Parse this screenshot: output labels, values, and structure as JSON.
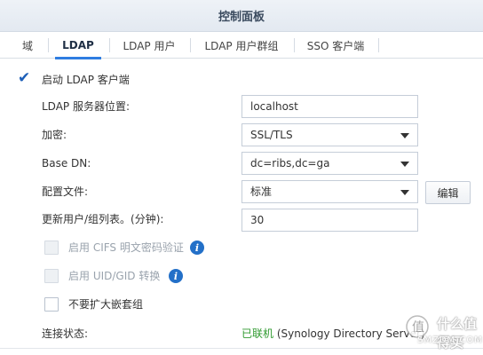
{
  "window": {
    "title": "控制面板"
  },
  "tabs": [
    {
      "label": "域"
    },
    {
      "label": "LDAP"
    },
    {
      "label": "LDAP 用户"
    },
    {
      "label": "LDAP 用户群组"
    },
    {
      "label": "SSO 客户端"
    }
  ],
  "form": {
    "enable_client": {
      "label": "启动 LDAP 客户端",
      "checked": true
    },
    "server_location": {
      "label": "LDAP 服务器位置:",
      "value": "localhost"
    },
    "encryption": {
      "label": "加密:",
      "value": "SSL/TLS"
    },
    "base_dn": {
      "label": "Base DN:",
      "value": "dc=ribs,dc=ga"
    },
    "profile": {
      "label": "配置文件:",
      "value": "标准",
      "edit_button": "编辑"
    },
    "refresh_interval": {
      "label": "更新用户/组列表。(分钟):",
      "value": "30"
    },
    "cifs_auth": {
      "label": "启用 CIFS 明文密码验证",
      "checked": false,
      "disabled": true
    },
    "uid_gid": {
      "label": "启用 UID/GID 转换",
      "checked": false,
      "disabled": true
    },
    "no_nested": {
      "label": "不要扩大嵌套组",
      "checked": false
    },
    "connection_status": {
      "label": "连接状态:",
      "status": "已联机",
      "detail": "(Synology Directory Server)"
    }
  },
  "watermark": {
    "text": "什么值得买",
    "small": "SMZDM.COM"
  },
  "colors": {
    "accent": "#2f7de1",
    "status_ok": "#2f9a2f",
    "info_icon": "#2370c8"
  }
}
